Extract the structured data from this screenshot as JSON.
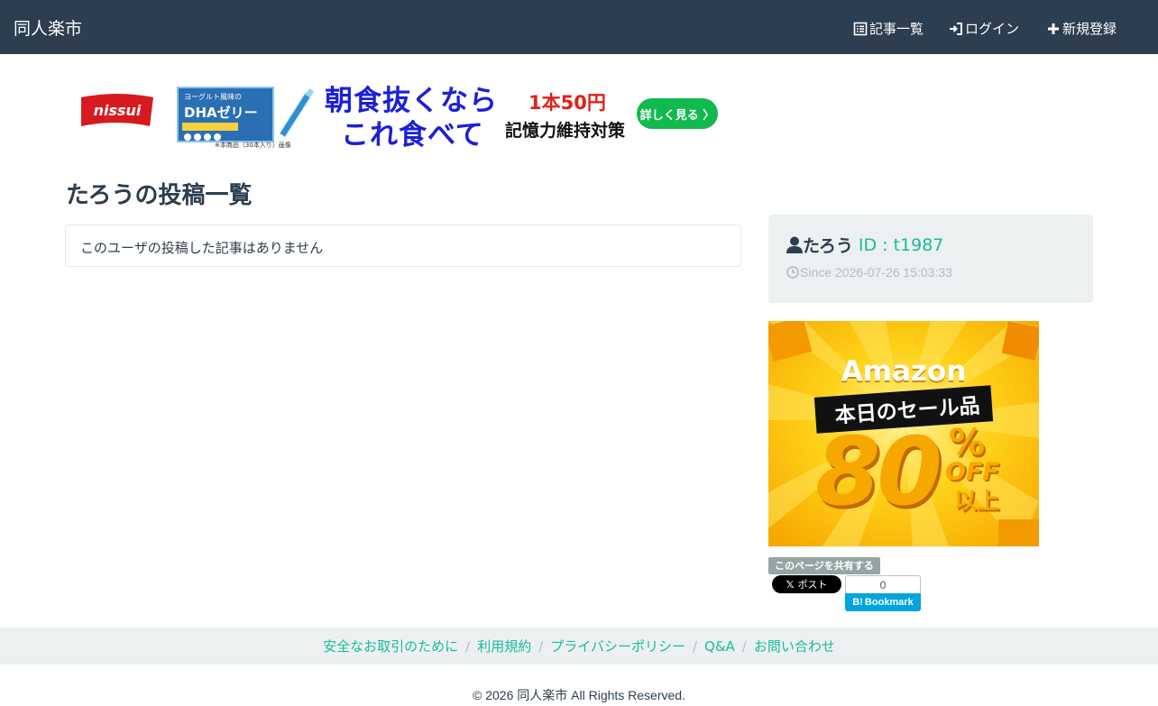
{
  "navbar": {
    "brand": "同人楽市",
    "items": [
      {
        "label": "記事一覧",
        "icon": "list-alt-icon"
      },
      {
        "label": "ログイン",
        "icon": "log-in-icon"
      },
      {
        "label": "新規登録",
        "icon": "plus-icon"
      }
    ]
  },
  "banner_ad": {
    "brand": "nissui",
    "product_label": "DHAゼリー",
    "product_tag": "ヨーグルト風味の",
    "product_note": "※本商品（30本入り）画像",
    "line1": "朝食抜くなら",
    "line2": "これ食べて",
    "price": "1本50円",
    "memory": "記憶力維持対策",
    "cta": "詳しく見る 〉",
    "colors": {
      "headline": "#1b1fd8",
      "price": "#e0201c",
      "cta": "#12b94e"
    }
  },
  "page_title": "たろうの投稿一覧",
  "empty_message": "このユーザの投稿した記事はありません",
  "profile": {
    "name": "たろう",
    "id_text": "ID : t1987",
    "since": "Since 2026-07-26 15:03:33"
  },
  "amazon_ad": {
    "title": "Amazon",
    "sale": "本日のセール品",
    "number": "80",
    "percent": "%",
    "off": "OFF",
    "suffix": "以上"
  },
  "share": {
    "label": "このページを共有する",
    "x_button": "ポスト",
    "hatena_count": "0",
    "hatena_button": "Bookmark"
  },
  "footer": {
    "links": [
      "安全なお取引のために",
      "利用規約",
      "プライバシーポリシー",
      "Q&A",
      "お問い合わせ"
    ],
    "copyright": "© 2026 同人楽市 All Rights Reserved."
  },
  "colors": {
    "navbar": "#2c3e50",
    "accent": "#18bc9c",
    "panel": "#ecf0f1"
  }
}
